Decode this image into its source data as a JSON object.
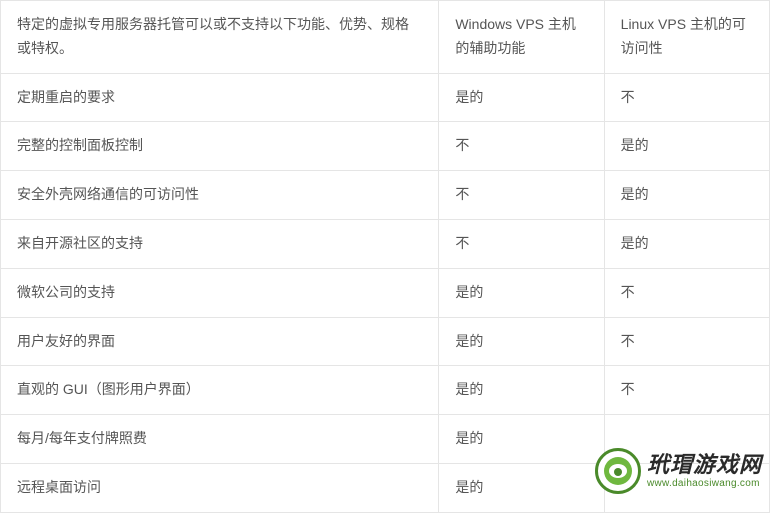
{
  "table": {
    "header": {
      "feature": "特定的虚拟专用服务器托管可以或不支持以下功能、优势、规格或特权。",
      "col_windows": "Windows VPS 主机的辅助功能",
      "col_linux": "Linux VPS 主机的可访问性"
    },
    "rows": [
      {
        "feature": "定期重启的要求",
        "windows": "是的",
        "linux": "不"
      },
      {
        "feature": "完整的控制面板控制",
        "windows": "不",
        "linux": "是的"
      },
      {
        "feature": "安全外壳网络通信的可访问性",
        "windows": "不",
        "linux": "是的"
      },
      {
        "feature": "来自开源社区的支持",
        "windows": "不",
        "linux": "是的"
      },
      {
        "feature": "微软公司的支持",
        "windows": "是的",
        "linux": "不"
      },
      {
        "feature": "用户友好的界面",
        "windows": "是的",
        "linux": "不"
      },
      {
        "feature": "直观的 GUI（图形用户界面）",
        "windows": "是的",
        "linux": "不"
      },
      {
        "feature": "每月/每年支付牌照费",
        "windows": "是的",
        "linux": ""
      },
      {
        "feature": "远程桌面访问",
        "windows": "是的",
        "linux": ""
      }
    ]
  },
  "watermark": {
    "title": "玳瑁游戏网",
    "url": "www.daihaosiwang.com"
  }
}
